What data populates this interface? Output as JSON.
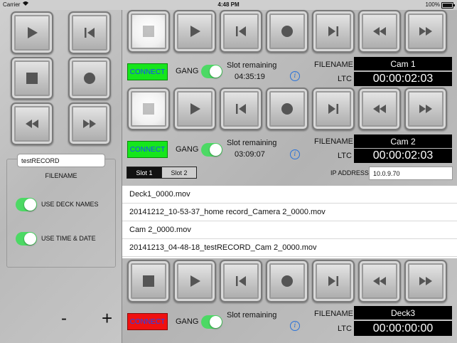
{
  "statusbar": {
    "carrier": "Carrier",
    "wifi_icon": "wifi-icon",
    "time": "4:48 PM",
    "battery": "100%"
  },
  "left": {
    "filename_value": "testRECORD",
    "filename_label": "FILENAME",
    "use_deck_names": "USE DECK NAMES",
    "use_time_date": "USE TIME & DATE",
    "minus": "-",
    "plus": "+"
  },
  "deck1": {
    "connect": "CONNECT",
    "gang": "GANG",
    "slot_remaining_label": "Slot remaining",
    "slot_remaining": "04:35:19",
    "filename_label": "FILENAME",
    "filename": "Cam 1",
    "ltc_label": "LTC",
    "ltc": "00:00:02:03"
  },
  "deck2": {
    "connect": "CONNECT",
    "gang": "GANG",
    "slot_remaining_label": "Slot remaining",
    "slot_remaining": "03:09:07",
    "filename_label": "FILENAME",
    "filename": "Cam 2",
    "ltc_label": "LTC",
    "ltc": "00:00:02:03"
  },
  "slots": {
    "slot1": "Slot 1",
    "slot2": "Slot 2"
  },
  "ip": {
    "label": "IP ADDRESS",
    "value": "10.0.9.70"
  },
  "files": [
    "Deck1_0000.mov",
    "20141212_10-53-37_home record_Camera 2_0000.mov",
    "Cam 2_0000.mov",
    " 20141213_04-48-18_testRECORD_Cam 2_0000.mov"
  ],
  "deck3": {
    "connect": "CONNECT",
    "gang": "GANG",
    "slot_remaining_label": "Slot remaining",
    "slot_remaining": "",
    "filename_label": "FILENAME",
    "filename": "Deck3",
    "ltc_label": "LTC",
    "ltc": "00:00:00:00"
  },
  "colors": {
    "connected": "#16e61c",
    "disconnected": "#f01010",
    "toggle_on": "#4cd964",
    "link_blue": "#1548ff"
  },
  "icons": [
    "stop-icon",
    "play-icon",
    "jump-start-icon",
    "record-icon",
    "jump-end-icon",
    "rewind-icon",
    "fast-forward-icon",
    "info-icon"
  ]
}
